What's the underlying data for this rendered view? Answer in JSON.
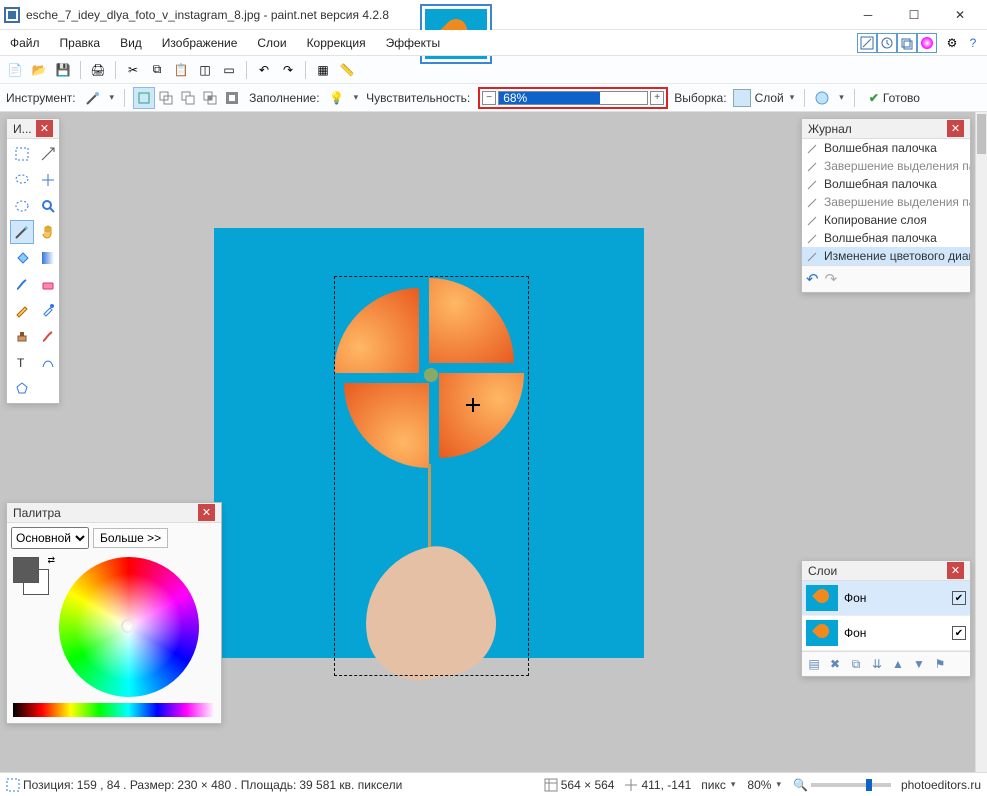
{
  "title": "esche_7_idey_dlya_foto_v_instagram_8.jpg - paint.net версия 4.2.8",
  "menu": [
    "Файл",
    "Правка",
    "Вид",
    "Изображение",
    "Слои",
    "Коррекция",
    "Эффекты"
  ],
  "toolbar2": {
    "instrument": "Инструмент:",
    "fill": "Заполнение:",
    "sensitivity": "Чувствительность:",
    "tolerance_pct": "68%",
    "tolerance_fill_pct": 68,
    "sample_lbl": "Выборка:",
    "sample_mode": "Слой",
    "commit": "Готово"
  },
  "tools_panel_title": "И...",
  "history": {
    "title": "Журнал",
    "items": [
      {
        "label": "Волшебная палочка",
        "muted": false
      },
      {
        "label": "Завершение выделения палочкой",
        "muted": true
      },
      {
        "label": "Волшебная палочка",
        "muted": false
      },
      {
        "label": "Завершение выделения палочкой",
        "muted": true
      },
      {
        "label": "Копирование слоя",
        "muted": false
      },
      {
        "label": "Волшебная палочка",
        "muted": false
      },
      {
        "label": "Изменение цветового диапазона",
        "muted": false,
        "selected": true
      }
    ]
  },
  "palette": {
    "title": "Палитра",
    "mode": "Основной",
    "more": "Больше >>"
  },
  "layers": {
    "title": "Слои",
    "items": [
      {
        "name": "Фон",
        "visible": true,
        "selected": true
      },
      {
        "name": "Фон",
        "visible": true,
        "selected": false
      }
    ]
  },
  "status": {
    "pos_label": "Позиция:",
    "pos": "159 , 84",
    "size_label": ". Размер:",
    "size": "230   × 480",
    "area_label": ". Площадь:",
    "area": "39 581 кв. пиксели",
    "doc_size": "564 × 564",
    "cursor": "411, -141",
    "unit": "пикс",
    "zoom": "80%",
    "brand": "photoeditors.ru"
  }
}
